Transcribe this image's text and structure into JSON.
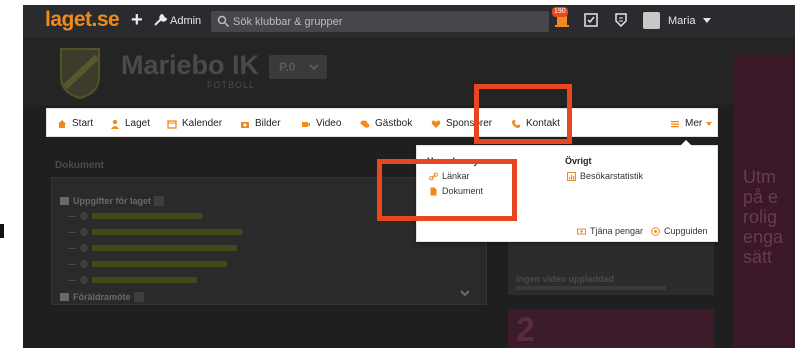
{
  "colors": {
    "accent": "#f08a1d",
    "highlight": "#e8461f",
    "topbar": "#2a2b2e"
  },
  "topbar": {
    "logo": "laget.se",
    "admin_label": "Admin",
    "search_placeholder": "Sök klubbar & grupper",
    "notification_count": "190",
    "user_name": "Maria"
  },
  "club": {
    "name": "Mariebo IK",
    "subtitle": "FOTBOLL",
    "sport_selector": "P.0"
  },
  "menu": {
    "items": [
      {
        "label": "Start",
        "icon": "home-icon"
      },
      {
        "label": "Laget",
        "icon": "user-icon"
      },
      {
        "label": "Kalender",
        "icon": "calendar-icon"
      },
      {
        "label": "Bilder",
        "icon": "camera-icon"
      },
      {
        "label": "Video",
        "icon": "video-icon"
      },
      {
        "label": "Gästbok",
        "icon": "chat-icon"
      },
      {
        "label": "Sponsorer",
        "icon": "heart-icon"
      },
      {
        "label": "Kontakt",
        "icon": "phone-icon"
      }
    ],
    "more_label": "Mer"
  },
  "dropdown": {
    "col1_heading": "Huvudmeny",
    "col1_links": [
      "Länkar",
      "Dokument"
    ],
    "col2_heading": "Övrigt",
    "col2_links": [
      "Besökarstatistik"
    ],
    "footer_links": [
      "Tjäna pengar",
      "Cupguiden"
    ]
  },
  "documents": {
    "title": "Dokument",
    "folder1": "Uppgifter för laget",
    "folder2": "Föräldramöte"
  },
  "video": {
    "title": "Ingen video uppladdad"
  },
  "sidead": {
    "lines": [
      "Utm",
      "på e",
      "rolig",
      "enga",
      "sätt"
    ]
  }
}
